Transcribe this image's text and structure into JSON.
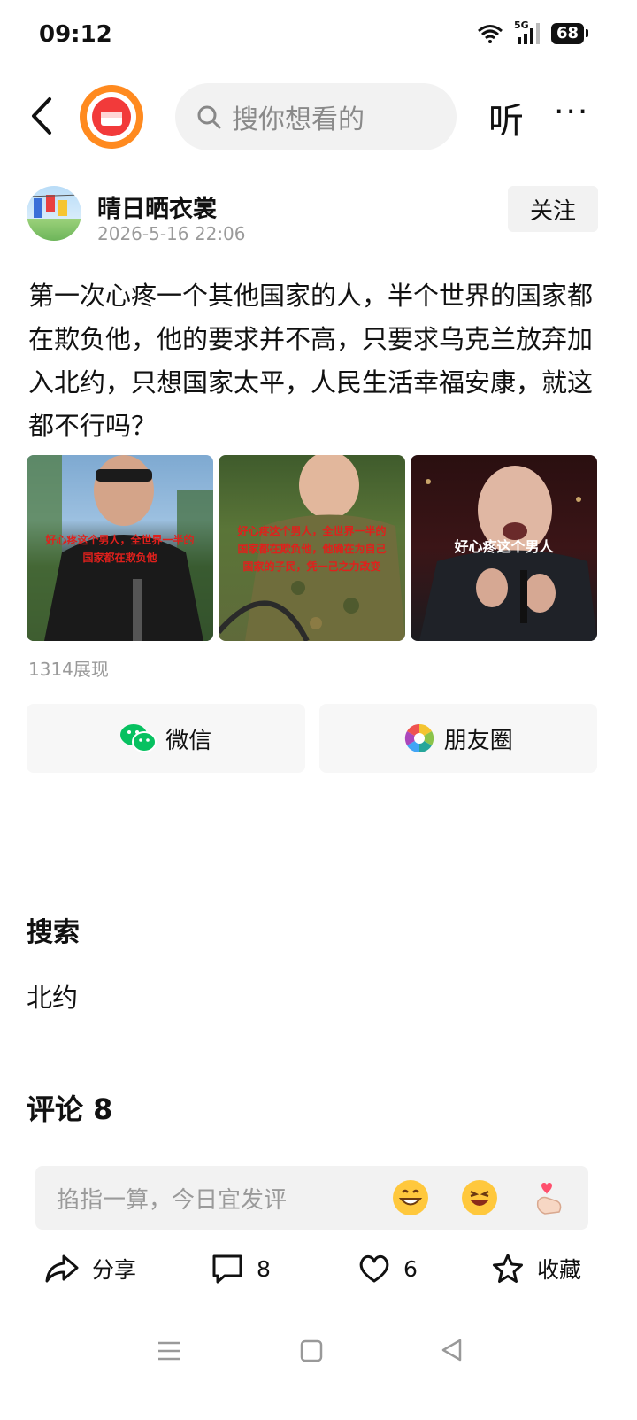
{
  "status_bar": {
    "time": "09:12",
    "network": "5G",
    "battery": "68"
  },
  "top_bar": {
    "search_placeholder": "搜你想看的",
    "listen_label": "听",
    "more_label": "···"
  },
  "author": {
    "name": "晴日晒衣裳",
    "time": "2026-5-16 22:06",
    "follow_label": "关注"
  },
  "post": {
    "text": "第一次心疼一个其他国家的人，半个世界的国家都在欺负他，他的要求并不高，只要求乌克兰放弃加入北约，只想国家太平，人民生活幸福安康，就这都不行吗？",
    "images": [
      {
        "caption_line1": "好心疼这个男人，全世界一半的",
        "caption_line2": "国家都在欺负他"
      },
      {
        "caption_line1": "好心疼这个男人，全世界一半的",
        "caption_line2": "国家都在欺负他，他确在为自己",
        "caption_line3": "国家的子民，凭一己之力改变"
      },
      {
        "caption_line1": "好心疼这个男人"
      }
    ],
    "views": "1314展现"
  },
  "share": {
    "wechat_label": "微信",
    "moments_label": "朋友圈"
  },
  "search_section": {
    "title": "搜索",
    "term": "北约"
  },
  "comments": {
    "title": "评论 8",
    "input_placeholder": "掐指一算，今日宜发评"
  },
  "actions": {
    "share_label": "分享",
    "comment_count": "8",
    "like_count": "6",
    "favorite_label": "收藏"
  },
  "colors": {
    "accent_orange": "#ff8a1f",
    "logo_red": "#f23a3a",
    "wechat_green": "#07c160"
  }
}
